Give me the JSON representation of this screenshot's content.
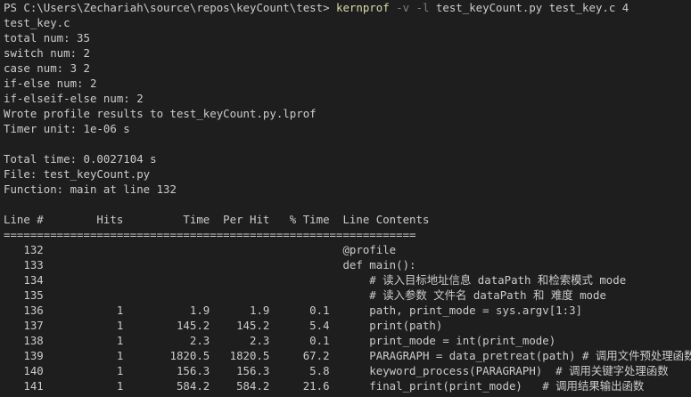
{
  "prompt": {
    "ps": "PS C:\\Users\\Zechariah\\source\\repos\\keyCount\\test> ",
    "command": "kernprof",
    "flags": " -v -l ",
    "args": "test_keyCount.py test_key.c 4"
  },
  "output_lines": [
    "test_key.c",
    "total num: 35",
    "switch num: 2",
    "case num: 3 2",
    "if-else num: 2",
    "if-elseif-else num: 2",
    "Wrote profile results to test_keyCount.py.lprof",
    "Timer unit: 1e-06 s",
    "",
    "Total time: 0.0027104 s",
    "File: test_keyCount.py",
    "Function: main at line 132",
    ""
  ],
  "table": {
    "headers": {
      "line": "Line #",
      "hits": "Hits",
      "time": "Time",
      "per_hit": "Per Hit",
      "pct_time": "% Time",
      "contents": "Line Contents"
    },
    "separator": "==============================================================",
    "rows": [
      {
        "line": "132",
        "hits": "",
        "time": "",
        "per_hit": "",
        "pct": "",
        "code": "@profile"
      },
      {
        "line": "133",
        "hits": "",
        "time": "",
        "per_hit": "",
        "pct": "",
        "code": "def main():"
      },
      {
        "line": "134",
        "hits": "",
        "time": "",
        "per_hit": "",
        "pct": "",
        "code": "    # 读入目标地址信息 dataPath 和检索模式 mode"
      },
      {
        "line": "135",
        "hits": "",
        "time": "",
        "per_hit": "",
        "pct": "",
        "code": "    # 读入参数 文件名 dataPath 和 难度 mode"
      },
      {
        "line": "136",
        "hits": "1",
        "time": "1.9",
        "per_hit": "1.9",
        "pct": "0.1",
        "code": "    path, print_mode = sys.argv[1:3]"
      },
      {
        "line": "137",
        "hits": "1",
        "time": "145.2",
        "per_hit": "145.2",
        "pct": "5.4",
        "code": "    print(path)"
      },
      {
        "line": "138",
        "hits": "1",
        "time": "2.3",
        "per_hit": "2.3",
        "pct": "0.1",
        "code": "    print_mode = int(print_mode)"
      },
      {
        "line": "139",
        "hits": "1",
        "time": "1820.5",
        "per_hit": "1820.5",
        "pct": "67.2",
        "code": "    PARAGRAPH = data_pretreat(path) # 调用文件预处理函数"
      },
      {
        "line": "140",
        "hits": "1",
        "time": "156.3",
        "per_hit": "156.3",
        "pct": "5.8",
        "code": "    keyword_process(PARAGRAPH)  # 调用关键字处理函数"
      },
      {
        "line": "141",
        "hits": "1",
        "time": "584.2",
        "per_hit": "584.2",
        "pct": "21.6",
        "code": "    final_print(print_mode)   # 调用结果输出函数"
      }
    ]
  },
  "colors": {
    "background": "#1e1e1e",
    "foreground": "#cccccc",
    "command": "#dcdcaa",
    "flag": "#808080"
  }
}
